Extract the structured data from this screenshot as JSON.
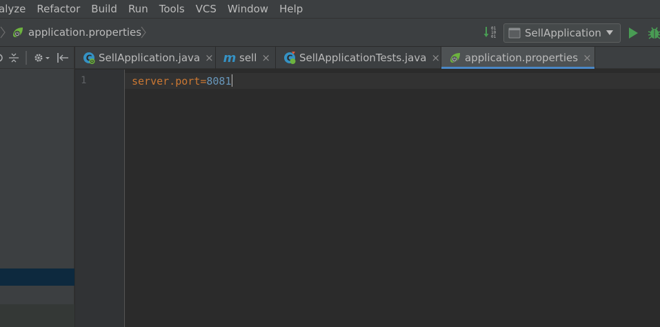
{
  "menubar": {
    "items": [
      "alyze",
      "Refactor",
      "Build",
      "Run",
      "Tools",
      "VCS",
      "Window",
      "Help"
    ]
  },
  "navbar": {
    "breadcrumb_file": "application.properties",
    "run_config": "SellApplication"
  },
  "tabs": [
    {
      "label": "SellApplication.java",
      "close": "×",
      "icon": "spring-class-icon",
      "active": false
    },
    {
      "label": "sell",
      "close": "×",
      "icon": "maven-icon",
      "active": false
    },
    {
      "label": "SellApplicationTests.java",
      "close": "×",
      "icon": "spring-test-class-icon",
      "active": false
    },
    {
      "label": "application.properties",
      "close": "×",
      "icon": "spring-leaf-icon",
      "active": true
    }
  ],
  "editor": {
    "line_numbers": [
      "1"
    ],
    "lines": [
      {
        "key": "server.port",
        "eq": "=",
        "value": "8081"
      }
    ]
  },
  "colors": {
    "background": "#2b2b2b",
    "panel": "#3c3f41",
    "accent": "#4a88c7",
    "property_key": "#cc7832",
    "property_value": "#6897bb",
    "run_green": "#499c54"
  }
}
